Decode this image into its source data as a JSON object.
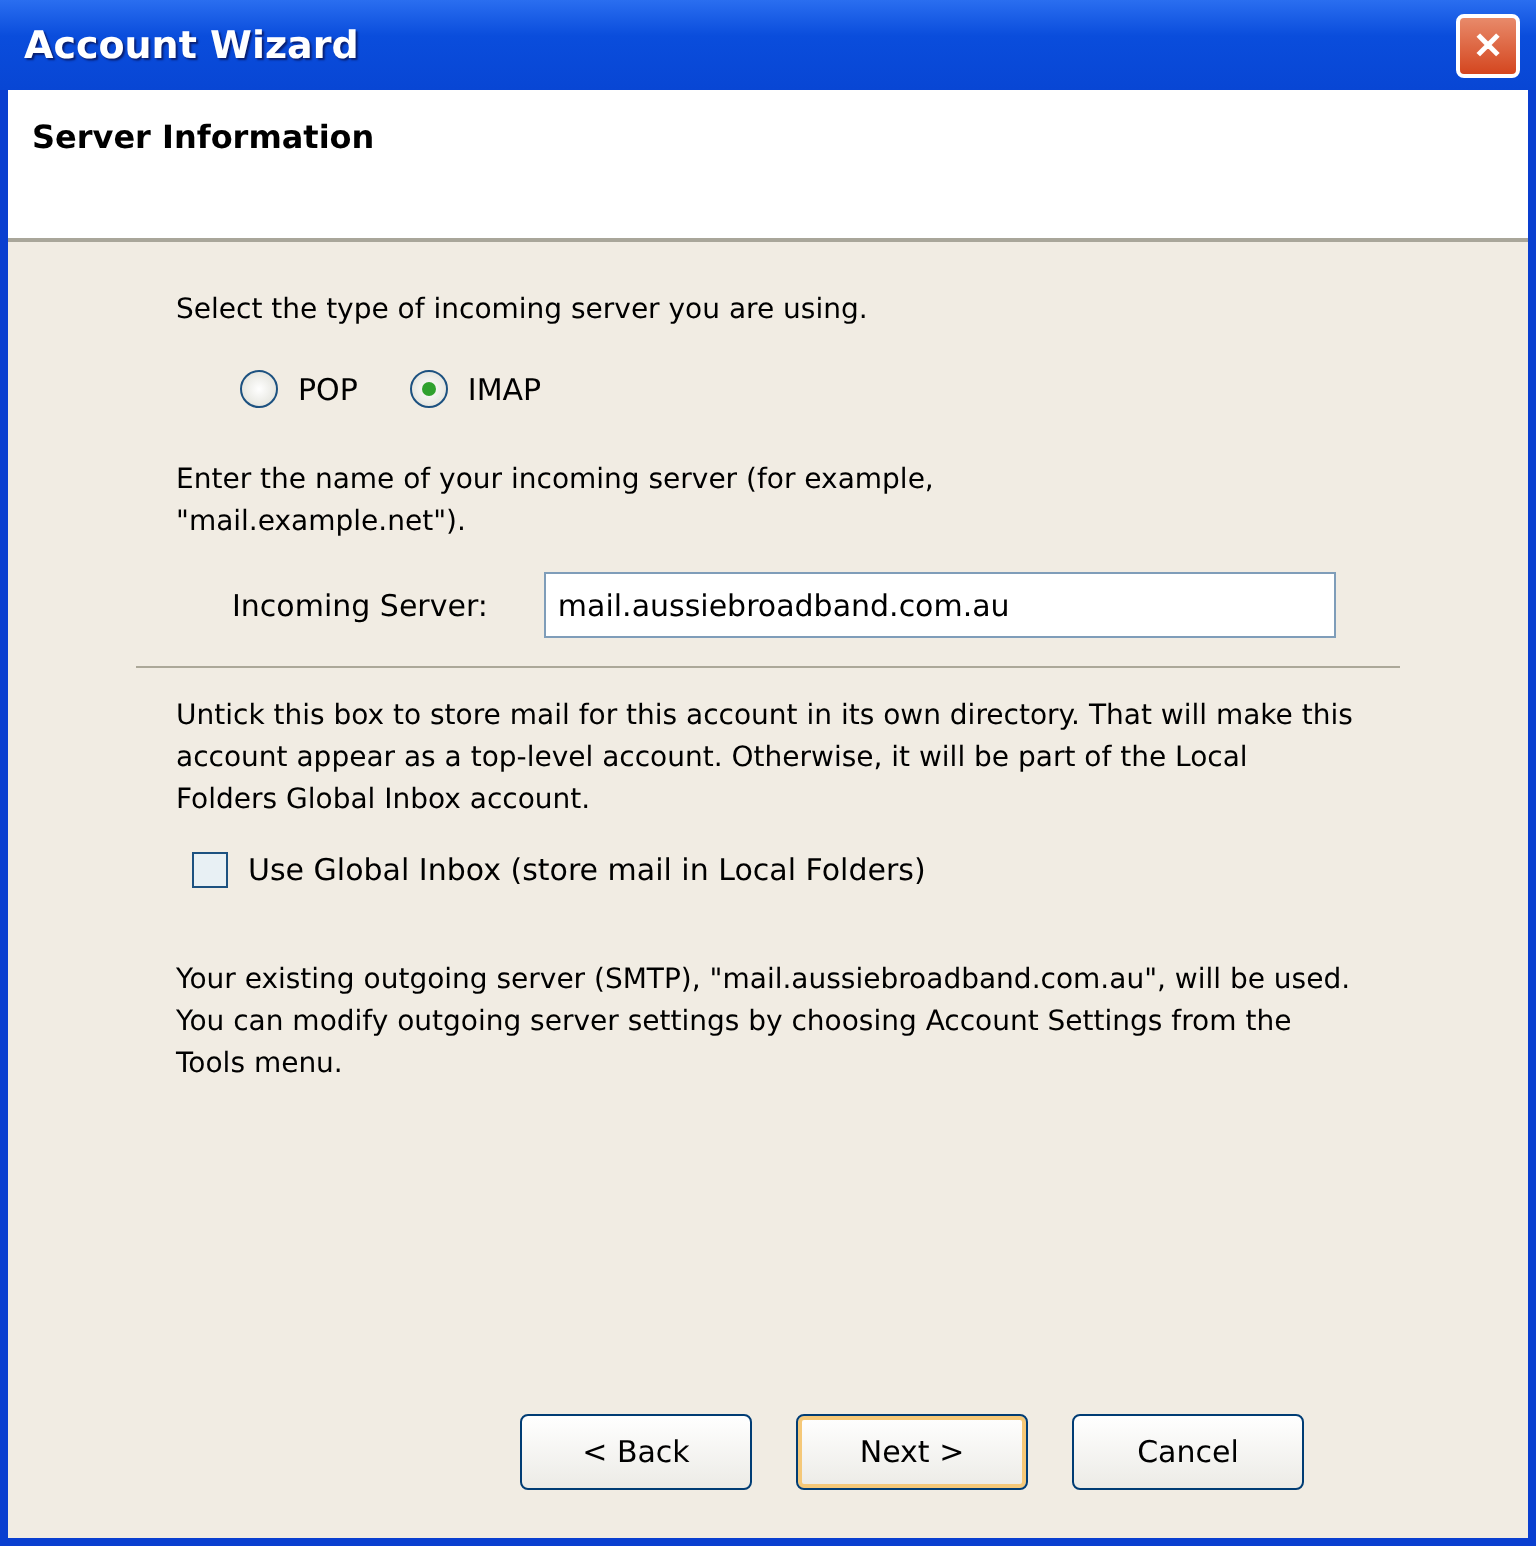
{
  "window": {
    "title": "Account Wizard",
    "close": "✕"
  },
  "header": {
    "title": "Server Information"
  },
  "server_type": {
    "prompt": "Select the type of incoming server you are using.",
    "options": [
      {
        "label": "POP",
        "selected": false
      },
      {
        "label": "IMAP",
        "selected": true
      }
    ]
  },
  "incoming": {
    "prompt": "Enter the name of your incoming server (for example, \"mail.example.net\").",
    "label": "Incoming Server:",
    "value": "mail.aussiebroadband.com.au"
  },
  "global_inbox": {
    "description": "Untick this box to store mail for this account in its own directory. That will make this account appear as a top-level account. Otherwise, it will be part of the Local Folders Global Inbox account.",
    "label": "Use Global Inbox (store mail in Local Folders)",
    "checked": false
  },
  "outgoing_note": "Your existing outgoing server (SMTP), \"mail.aussiebroadband.com.au\", will be used. You can modify outgoing server settings by choosing Account Settings from the Tools menu.",
  "buttons": [
    {
      "label": "< Back",
      "default": false
    },
    {
      "label": "Next >",
      "default": true
    },
    {
      "label": "Cancel",
      "default": false
    }
  ]
}
